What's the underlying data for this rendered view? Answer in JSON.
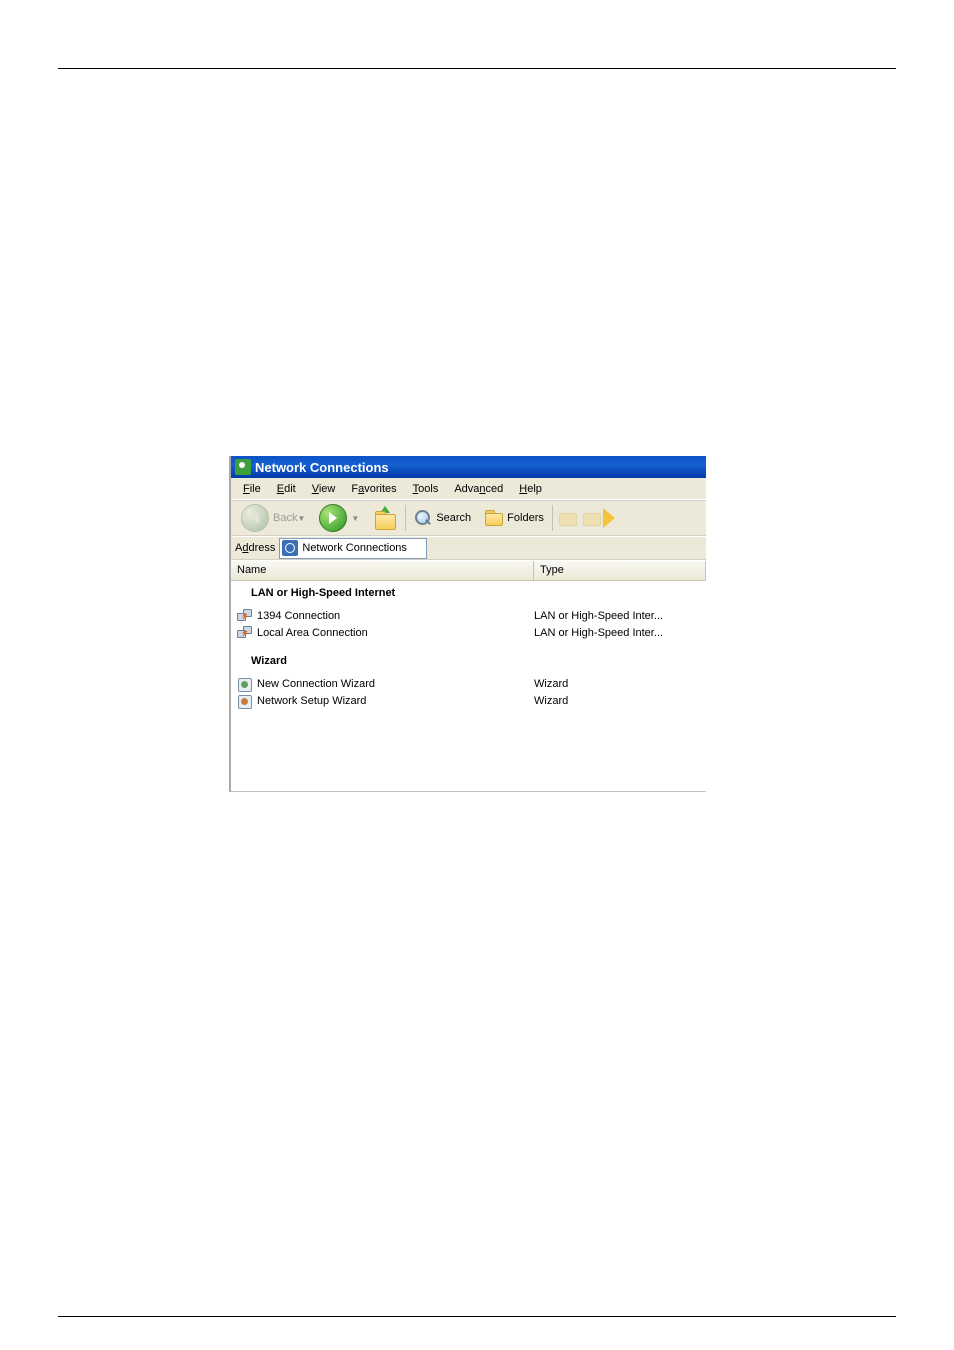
{
  "titlebar": {
    "title": "Network Connections"
  },
  "menu": [
    "File",
    "Edit",
    "View",
    "Favorites",
    "Tools",
    "Advanced",
    "Help"
  ],
  "menu_mnemonic_index": [
    0,
    0,
    0,
    1,
    0,
    4,
    0
  ],
  "toolbar": {
    "back": "Back",
    "search": "Search",
    "folders": "Folders"
  },
  "address": {
    "label": "Address",
    "value": "Network Connections"
  },
  "columns": {
    "name": "Name",
    "type": "Type"
  },
  "groups": [
    {
      "label": "LAN or High-Speed Internet",
      "items": [
        {
          "icon": "conn",
          "name": "1394 Connection",
          "type": "LAN or High-Speed Inter..."
        },
        {
          "icon": "conn",
          "name": "Local Area Connection",
          "type": "LAN or High-Speed Inter..."
        }
      ]
    },
    {
      "label": "Wizard",
      "items": [
        {
          "icon": "wiz",
          "name": "New Connection Wizard",
          "type": "Wizard"
        },
        {
          "icon": "setup",
          "name": "Network Setup Wizard",
          "type": "Wizard"
        }
      ]
    }
  ]
}
